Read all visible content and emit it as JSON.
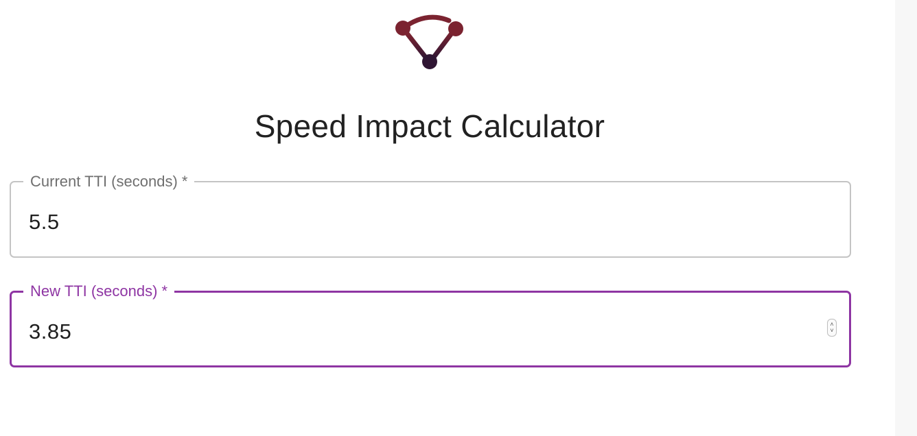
{
  "app": {
    "title": "Speed Impact Calculator",
    "accent_color": "#8e35a3",
    "logo": {
      "icon": "network-nodes-logo",
      "colors": [
        "#7b2330",
        "#5a1f3e",
        "#2f1533"
      ]
    }
  },
  "form": {
    "current_tti": {
      "label": "Current TTI (seconds) *",
      "value": "5.5"
    },
    "new_tti": {
      "label": "New TTI (seconds) *",
      "value": "3.85",
      "spinner_up": "˄",
      "spinner_down": "˅"
    }
  }
}
